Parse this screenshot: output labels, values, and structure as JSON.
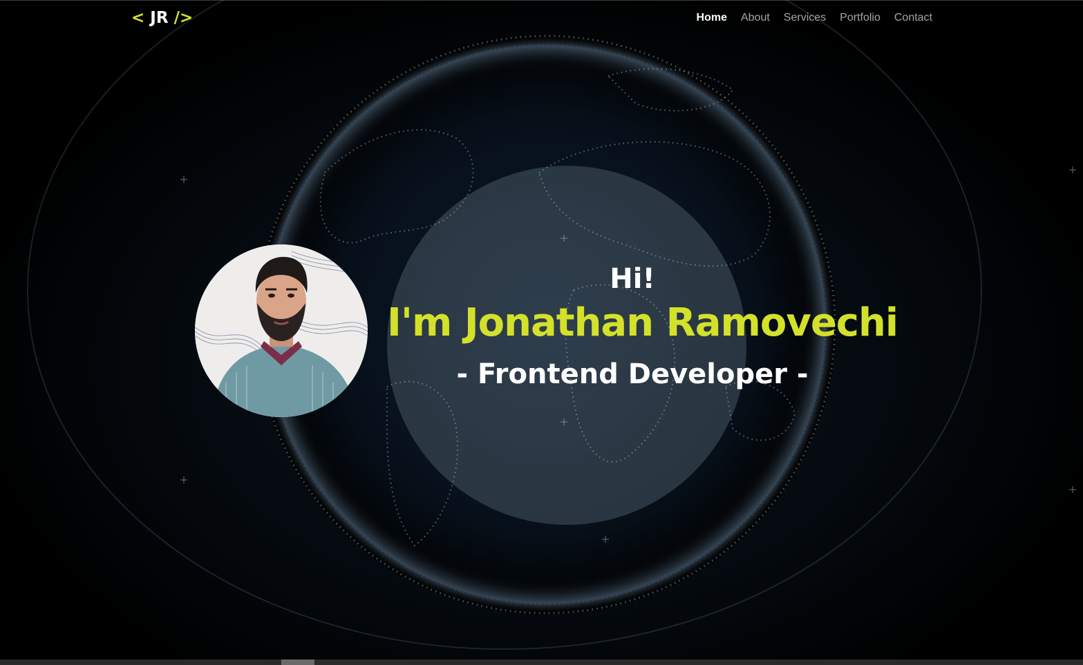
{
  "logo": {
    "open": "<",
    "initials": "JR",
    "close": "/>"
  },
  "nav": {
    "items": [
      {
        "label": "Home",
        "active": true
      },
      {
        "label": "About",
        "active": false
      },
      {
        "label": "Services",
        "active": false
      },
      {
        "label": "Portfolio",
        "active": false
      },
      {
        "label": "Contact",
        "active": false
      }
    ]
  },
  "hero": {
    "greeting": "Hi!",
    "name": "I'm Jonathan Ramovechi",
    "role": "- Frontend Developer -"
  },
  "colors": {
    "accent": "#d4e12a",
    "background": "#000000",
    "nav_inactive": "#a6a6a6"
  }
}
